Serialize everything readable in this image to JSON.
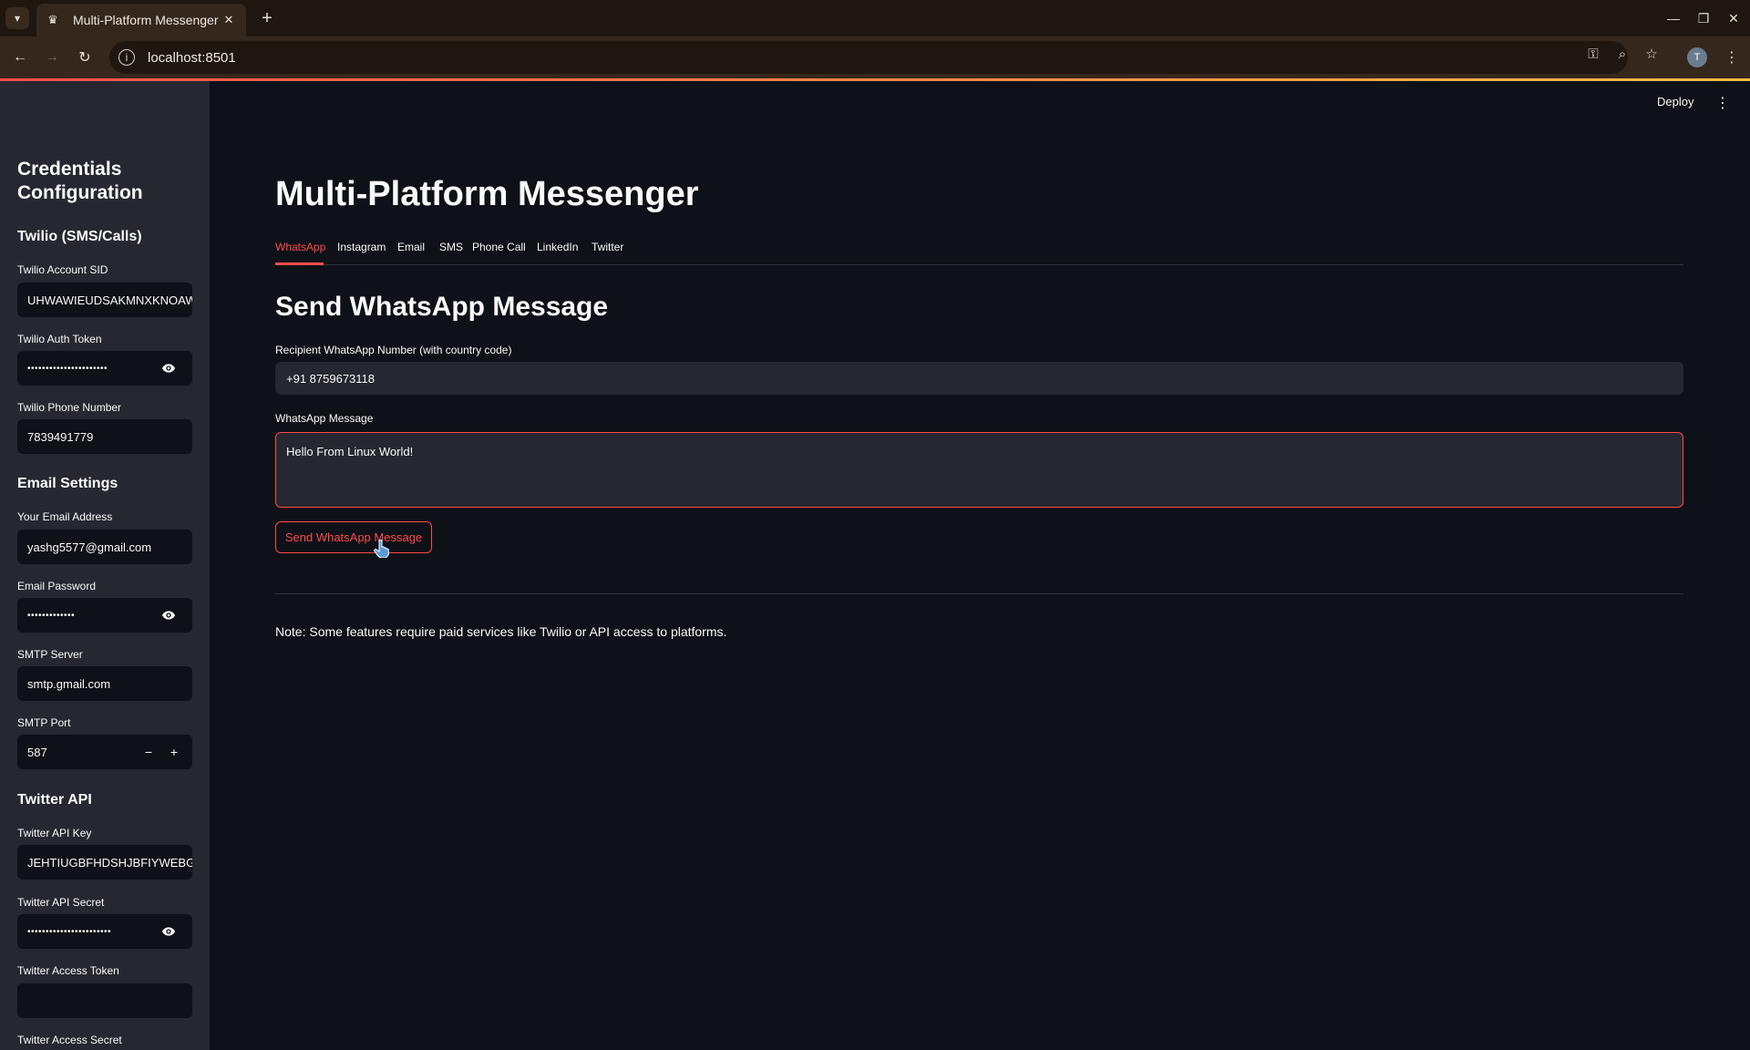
{
  "browser": {
    "tab_title": "Multi-Platform Messenger",
    "url": "localhost:8501",
    "profile_initial": "T"
  },
  "app": {
    "deploy_label": "Deploy",
    "title": "Multi-Platform Messenger",
    "tabs": [
      "WhatsApp",
      "Instagram",
      "Email",
      "SMS",
      "Phone Call",
      "LinkedIn",
      "Twitter"
    ],
    "active_tab": "WhatsApp",
    "section_title": "Send WhatsApp Message",
    "recipient_label": "Recipient WhatsApp Number (with country code)",
    "recipient_value": "+91 8759673118",
    "message_label": "WhatsApp Message",
    "message_value": "Hello From Linux World!",
    "send_button": "Send WhatsApp Message",
    "note": "Note: Some features require paid services like Twilio or API access to platforms.",
    "accent_color": "#ff4b4b"
  },
  "sidebar": {
    "title": "Credentials Configuration",
    "twilio_section": "Twilio (SMS/Calls)",
    "twilio_sid_label": "Twilio Account SID",
    "twilio_sid_value": "UHWAWIEUDSAKMNXKNOAWHDUHJ",
    "twilio_token_label": "Twilio Auth Token",
    "twilio_token_mask": "••••••••••••••••••••••",
    "twilio_phone_label": "Twilio Phone Number",
    "twilio_phone_value": "7839491779",
    "email_section": "Email Settings",
    "email_label": "Your Email Address",
    "email_value": "yashg5577@gmail.com",
    "email_password_label": "Email Password",
    "email_password_mask": "•••••••••••••",
    "smtp_server_label": "SMTP Server",
    "smtp_server_value": "smtp.gmail.com",
    "smtp_port_label": "SMTP Port",
    "smtp_port_value": "587",
    "twitter_section": "Twitter API",
    "twitter_key_label": "Twitter API Key",
    "twitter_key_value": "JEHTIUGBFHDSHJBFIYWEBGHJ",
    "twitter_secret_label": "Twitter API Secret",
    "twitter_secret_mask": "•••••••••••••••••••••••",
    "twitter_access_token_label": "Twitter Access Token",
    "twitter_access_token_value": "",
    "twitter_access_secret_label": "Twitter Access Secret"
  }
}
